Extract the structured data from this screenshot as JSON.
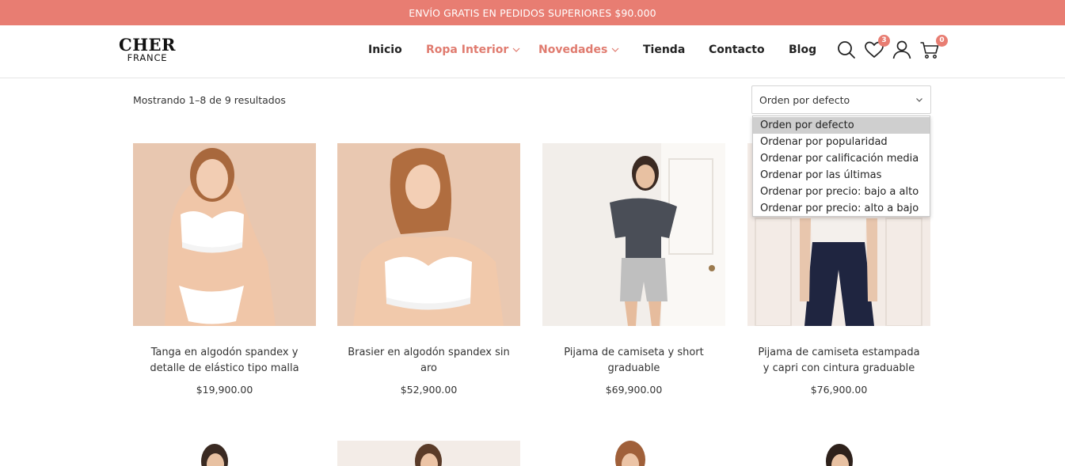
{
  "promo_bar": {
    "text": "ENVÍO GRATIS EN PEDIDOS SUPERIORES $90.000"
  },
  "logo": {
    "line1": "CHER",
    "line2": "FRANCE"
  },
  "nav": {
    "items": [
      {
        "label": "Inicio"
      },
      {
        "label": "Ropa Interior"
      },
      {
        "label": "Novedades"
      },
      {
        "label": "Tienda"
      },
      {
        "label": "Contacto"
      },
      {
        "label": "Blog"
      }
    ],
    "accent_color": "#e07b6f"
  },
  "header_icons": {
    "wishlist_count": "3",
    "cart_count": "0"
  },
  "results_text": "Mostrando 1–8 de 9 resultados",
  "sort": {
    "selected": "Orden por defecto",
    "options": [
      "Orden por defecto",
      "Ordenar por popularidad",
      "Ordenar por calificación media",
      "Ordenar por las últimas",
      "Ordenar por precio: bajo a alto",
      "Ordenar por precio: alto a bajo"
    ]
  },
  "products": [
    {
      "title": "Tanga en algodón spandex y detalle de elástico tipo malla",
      "price": "$19,900.00"
    },
    {
      "title": "Brasier en algodón spandex sin aro",
      "price": "$52,900.00"
    },
    {
      "title": "Pijama de camiseta y short graduable",
      "price": "$69,900.00"
    },
    {
      "title": "Pijama de camiseta estampada y capri con cintura graduable",
      "price": "$76,900.00"
    }
  ],
  "colors": {
    "promo": "#e87d72",
    "badge": "#e87d72"
  }
}
